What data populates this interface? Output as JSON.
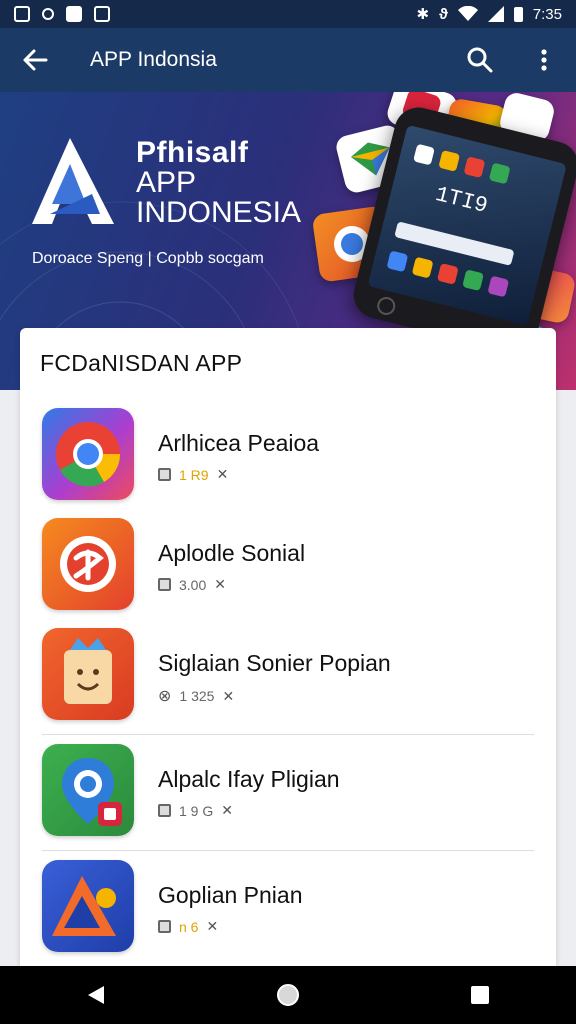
{
  "status_bar": {
    "time": "7:35",
    "icons": [
      "notification-icon",
      "gallery-icon",
      "image-icon",
      "app-icon",
      "bluetooth-icon",
      "vibrate-icon",
      "wifi-icon",
      "signal-icon",
      "battery-icon"
    ]
  },
  "app_bar": {
    "title": "APP Indonsia",
    "back_icon": "arrow-back-icon",
    "search_icon": "search-icon",
    "menu_icon": "more-vert-icon",
    "color": "#1c3a66"
  },
  "banner": {
    "brand_line1": "Pfhisalf",
    "brand_line2": "APP",
    "brand_line3": "INDONESIA",
    "tagline": "Doroace Speng | Copbb socgam",
    "phone_clock": "1TI9",
    "colors": [
      "#1f3f82",
      "#5a2a86",
      "#c0306c"
    ]
  },
  "section": {
    "title": "FCDaNISDAN APP"
  },
  "apps": [
    {
      "name": "Arlhicea Peaioa",
      "meta": "1 R9",
      "meta_color": "#e0a400"
    },
    {
      "name": "Aplodle Sonial",
      "meta": "3.00",
      "meta_color": "#666666"
    },
    {
      "name": "Siglaian Sonier Popian",
      "meta": "1 325",
      "meta_color": "#666666"
    },
    {
      "name": "Alpalc Ifay Pligian",
      "meta": "1 9 G",
      "meta_color": "#666666"
    },
    {
      "name": "Goplian Pnian",
      "meta": "n 6",
      "meta_color": "#e0a400"
    }
  ],
  "nav": {
    "back_icon": "nav-back-icon",
    "home_icon": "nav-home-icon",
    "recents_icon": "nav-recents-icon"
  }
}
